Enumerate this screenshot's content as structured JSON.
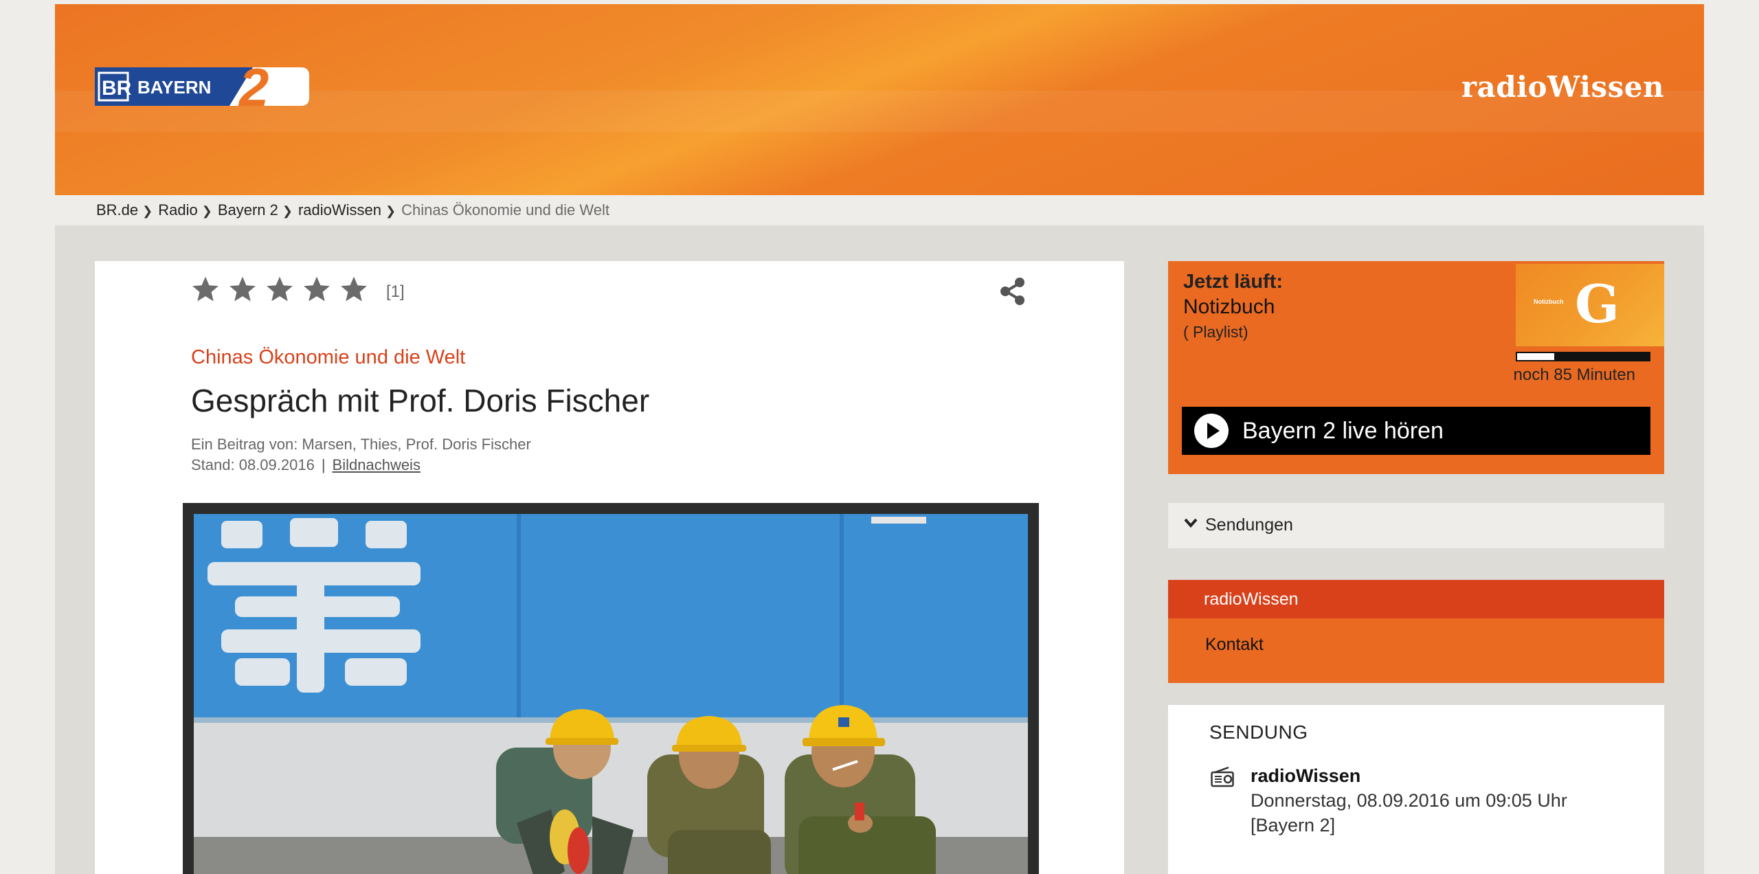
{
  "header": {
    "logo_text": "BR BAYERN 2",
    "brand": "radioWissen"
  },
  "breadcrumb": [
    {
      "label": "BR.de"
    },
    {
      "label": "Radio"
    },
    {
      "label": "Bayern 2"
    },
    {
      "label": "radioWissen"
    },
    {
      "label": "Chinas Ökonomie und die Welt",
      "current": true
    }
  ],
  "article": {
    "rating_stars": 5,
    "rating_count": "[1]",
    "kicker": "Chinas Ökonomie und die Welt",
    "title": "Gespräch mit Prof. Doris Fischer",
    "author_line": "Ein Beitrag von: Marsen, Thies, Prof. Doris Fischer",
    "stand": "Stand: 08.09.2016",
    "bildnachweis": "Bildnachweis"
  },
  "now_playing": {
    "label": "Jetzt läuft:",
    "show": "Notizbuch",
    "playlist": "( Playlist)",
    "thumb_label": "Notizbuch",
    "thumb_letter": "G",
    "progress_fraction": 0.28,
    "remaining": "noch 85 Minuten",
    "live_button": "Bayern 2 live hören"
  },
  "sendungen": {
    "label": "Sendungen"
  },
  "nav": {
    "active": "radioWissen",
    "items": [
      "Kontakt"
    ]
  },
  "sendung": {
    "heading": "SENDUNG",
    "name": "radioWissen",
    "date": "Donnerstag, 08.09.2016 um 09:05 Uhr",
    "station": "[Bayern 2]"
  },
  "colors": {
    "header_orange": "#ec7423",
    "accent_red": "#d9411b",
    "sidebar_orange": "#ea6a22"
  }
}
